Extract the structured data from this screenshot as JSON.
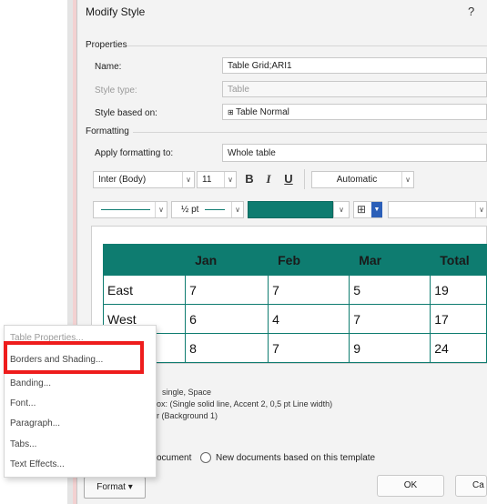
{
  "dialog": {
    "title": "Modify Style",
    "help": "?"
  },
  "properties": {
    "group": "Properties",
    "name_label": "Name:",
    "name_value": "Table Grid;ARI1",
    "type_label": "Style type:",
    "type_value": "Table",
    "based_label": "Style based on:",
    "based_value": "Table Normal"
  },
  "formatting": {
    "group": "Formatting",
    "apply_label": "Apply formatting to:",
    "apply_value": "Whole table",
    "font": "Inter (Body)",
    "size": "11",
    "bold": "B",
    "italic": "I",
    "underline": "U",
    "color": "Automatic",
    "line_width": "½ pt",
    "shading_color": "#0e7c70"
  },
  "preview_table": {
    "headers": [
      "",
      "Jan",
      "Feb",
      "Mar",
      "Total"
    ],
    "rows": [
      [
        "East",
        "7",
        "7",
        "5",
        "19"
      ],
      [
        "West",
        "6",
        "4",
        "7",
        "17"
      ],
      [
        "",
        "8",
        "7",
        "9",
        "24"
      ]
    ]
  },
  "description": {
    "line1": "single, Space",
    "line2": "ox: (Single solid line, Accent 2,  0,5 pt Line width)",
    "line3": "r (Background 1)"
  },
  "options": {
    "only_doc": "ocument",
    "new_docs": "New documents based on this template"
  },
  "buttons": {
    "ok": "OK",
    "cancel": "Ca",
    "format": "Format ▾"
  },
  "menu": {
    "items": [
      "Table Properties...",
      "Borders and Shading...",
      "Banding...",
      "Font...",
      "Paragraph...",
      "Tabs...",
      "Text Effects..."
    ]
  },
  "colors": {
    "accent": "#0e7c70",
    "highlight": "#ee1c1c"
  }
}
